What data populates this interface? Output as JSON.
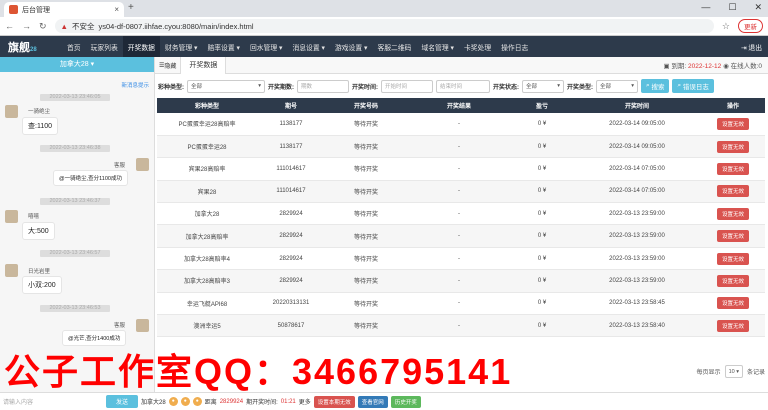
{
  "browser": {
    "tab_title": "后台管理",
    "insecure_label": "不安全",
    "url": "ys04-df-0807.iihfae.cyou:8080/main/index.html",
    "update_label": "更新"
  },
  "header": {
    "logo": "旗舰",
    "logo_sub": "28",
    "menu": [
      "首页",
      "玩家列表",
      "开奖数据",
      "财务管理 ▾",
      "赔率设置 ▾",
      "回水管理 ▾",
      "消息设置 ▾",
      "游戏设置 ▾",
      "客服二维码",
      "域名管理 ▾",
      "卡奖处理",
      "操作日志"
    ],
    "logout": "退出"
  },
  "sidebar": {
    "title": "加拿大28 ▾",
    "hint": "新消息提示",
    "timestamps": [
      "2022-03-13 23:46:05",
      "2022-03-13 23:46:38",
      "2022-03-13 23:46:37",
      "2022-03-13 23:46:57",
      "2022-03-13 23:46:53"
    ],
    "messages": [
      {
        "nick": "一骑绝尘",
        "text": "查:1100"
      },
      {
        "nick": "客服",
        "text": "@一骑绝尘,查分1100成功"
      },
      {
        "nick": "嘻嘻",
        "text": "大:500"
      },
      {
        "nick": "日光岩里",
        "text": "小双:200"
      },
      {
        "nick": "客服",
        "text": "@光芒,查分1400成功"
      }
    ]
  },
  "tabs": {
    "toggle": "隐藏",
    "active": "开奖数据",
    "expire_label": "到期:",
    "expire_date": "2022-12-12",
    "online_label": "在线人数:0"
  },
  "filters": {
    "type_label": "彩种类型:",
    "type_value": "全部",
    "issue_label": "开奖期数:",
    "issue_placeholder": "期数",
    "time_label": "开奖时间:",
    "start_placeholder": "开始时间",
    "end_placeholder": "结束时间",
    "status_label": "开奖状态:",
    "status_value": "全部",
    "kind_label": "开奖类型:",
    "kind_value": "全部",
    "search_btn": "搜索",
    "error_btn": "错误日志"
  },
  "table": {
    "headers": [
      "彩种类型",
      "期号",
      "开奖号码",
      "开奖结果",
      "盈亏",
      "开奖时间",
      "操作"
    ],
    "rows": [
      [
        "PC蛋蛋幸运28高赔率",
        "1138177",
        "等待开奖",
        "-",
        "0 ¥",
        "2022-03-14 09:05:00",
        "设置无效"
      ],
      [
        "PC蛋蛋幸运28",
        "1138177",
        "等待开奖",
        "-",
        "0 ¥",
        "2022-03-14 09:05:00",
        "设置无效"
      ],
      [
        "宾果28高赔率",
        "111014617",
        "等待开奖",
        "-",
        "0 ¥",
        "2022-03-14 07:05:00",
        "设置无效"
      ],
      [
        "宾果28",
        "111014617",
        "等待开奖",
        "-",
        "0 ¥",
        "2022-03-14 07:05:00",
        "设置无效"
      ],
      [
        "加拿大28",
        "2829924",
        "等待开奖",
        "-",
        "0 ¥",
        "2022-03-13 23:59:00",
        "设置无效"
      ],
      [
        "加拿大28高赔率",
        "2829924",
        "等待开奖",
        "-",
        "0 ¥",
        "2022-03-13 23:59:00",
        "设置无效"
      ],
      [
        "加拿大28高赔率4",
        "2829924",
        "等待开奖",
        "-",
        "0 ¥",
        "2022-03-13 23:59:00",
        "设置无效"
      ],
      [
        "加拿大28高赔率3",
        "2829924",
        "等待开奖",
        "-",
        "0 ¥",
        "2022-03-13 23:59:00",
        "设置无效"
      ],
      [
        "幸运飞艇API68",
        "20220313131",
        "等待开奖",
        "-",
        "0 ¥",
        "2022-03-13 23:58:45",
        "设置无效"
      ],
      [
        "澳洲幸运5",
        "50878617",
        "等待开奖",
        "-",
        "0 ¥",
        "2022-03-13 23:58:40",
        "设置无效"
      ]
    ]
  },
  "pager": {
    "page_label": "每页显示",
    "page_size": "10 ▾",
    "suffix": "条记录"
  },
  "bottom": {
    "input_placeholder": "请输入内容",
    "send": "发送",
    "game": "加拿大28",
    "issue_label": "距离",
    "issue": "2829924",
    "countdown_label": "期开奖时间:",
    "countdown": "01:21",
    "more": "更多",
    "btn1": "设置本期无效",
    "btn2": "查看官网",
    "btn3": "历史开奖"
  },
  "watermark": "公子工作室QQ：3466795141"
}
